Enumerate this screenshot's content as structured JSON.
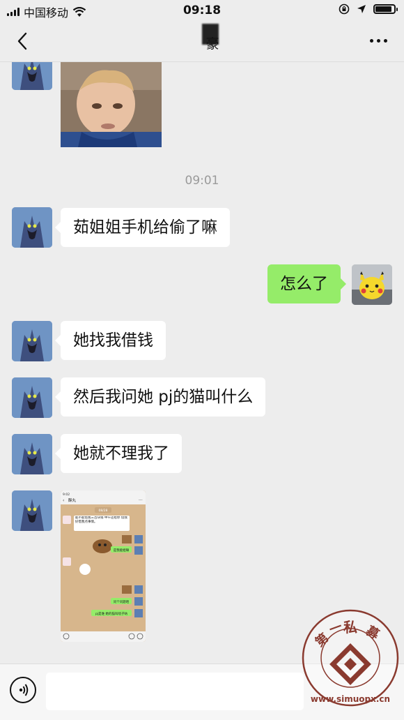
{
  "status_bar": {
    "carrier": "中国移动",
    "time": "09:18",
    "battery_level": 0.9
  },
  "nav": {
    "title": "豪",
    "back_icon": "chevron-left-icon",
    "more_icon": "more-dots-icon"
  },
  "chat": {
    "timestamp": "09:01",
    "messages": [
      {
        "side": "left",
        "text": "茹姐姐手机给偷了嘛"
      },
      {
        "side": "right",
        "text": "怎么了"
      },
      {
        "side": "left",
        "text": "她找我借钱"
      },
      {
        "side": "left",
        "text": "然后我问她 pj的猫叫什么"
      },
      {
        "side": "left",
        "text": "她就不理我了"
      }
    ]
  },
  "embedded_screenshot": {
    "time": "9:02",
    "title": "酥丸",
    "date": "08/28",
    "msg_1": "能不能借我三百块钱 中午还给你 借我好借我点事情。",
    "msg_2": "是我能姐嘛",
    "msg_3": "问个问题哈",
    "msg_4": "pj是谁 她的猫叫啥子呐"
  },
  "watermark": {
    "text": "第一私募",
    "url": "www.simuopx.cn"
  },
  "colors": {
    "background": "#ededed",
    "bubble_left": "#ffffff",
    "bubble_right": "#95ec69"
  }
}
